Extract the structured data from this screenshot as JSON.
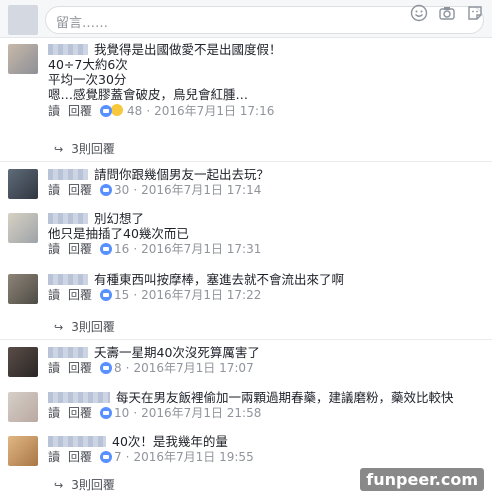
{
  "composer": {
    "placeholder": "留言……",
    "icons": [
      "emoji-icon",
      "camera-icon",
      "sticker-icon"
    ]
  },
  "actions": {
    "reply": "回覆"
  },
  "comments": [
    {
      "lines": [
        "我覺得是出國做愛不是出國度假！",
        "40÷7大約6次",
        "平均一次30分",
        "嗯…感覺膠蓋會破皮，鳥兒會紅腫…"
      ],
      "action_label": "讀",
      "reactions": [
        "like",
        "haha"
      ],
      "count": "48",
      "time": "2016年7月1日 17:16",
      "replies": "3則回覆"
    },
    {
      "lines": [
        "請問你跟幾個男友一起出去玩？"
      ],
      "action_label": "讀",
      "reactions": [
        "like"
      ],
      "count": "30",
      "time": "2016年7月1日 17:14",
      "replies": ""
    },
    {
      "lines": [
        "別幻想了",
        "他只是抽插了40幾次而已"
      ],
      "action_label": "讀",
      "reactions": [
        "like"
      ],
      "count": "16",
      "time": "2016年7月1日 17:31",
      "replies": ""
    },
    {
      "lines": [
        "有種東西叫按摩棒，塞進去就不會流出來了啊"
      ],
      "action_label": "讀",
      "reactions": [
        "like"
      ],
      "count": "15",
      "time": "2016年7月1日 17:22",
      "replies": "3則回覆"
    },
    {
      "lines": [
        "夭壽一星期40次沒死算厲害了"
      ],
      "action_label": "讀",
      "reactions": [
        "like"
      ],
      "count": "8",
      "time": "2016年7月1日 17:07",
      "replies": ""
    },
    {
      "lines": [
        "每天在男友飯裡偷加一兩顆過期春藥，建議磨粉，藥效比較快"
      ],
      "action_label": "讀",
      "reactions": [
        "like"
      ],
      "count": "10",
      "time": "2016年7月1日 21:58",
      "replies": ""
    },
    {
      "lines": [
        "40次！是我幾年的量"
      ],
      "action_label": "讀",
      "reactions": [
        "like"
      ],
      "count": "7",
      "time": "2016年7月1日 19:55",
      "replies": "3則回覆"
    }
  ],
  "watermark": "funpeer.com"
}
